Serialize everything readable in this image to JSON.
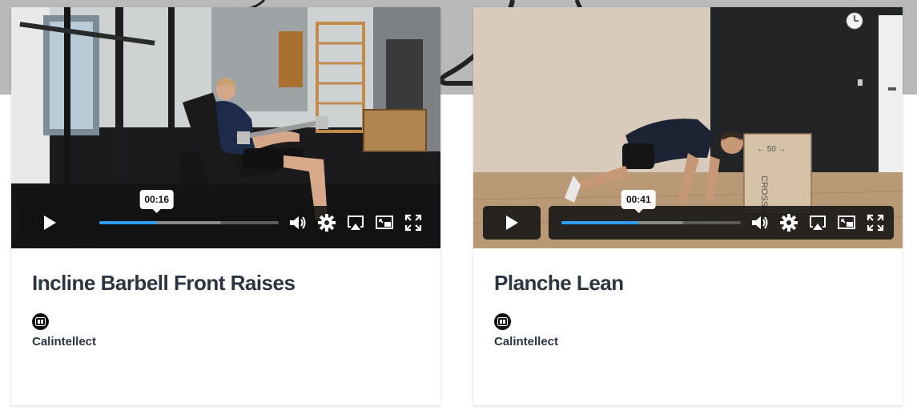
{
  "cards": [
    {
      "title": "Incline Barbell Front Raises",
      "author": "Calintellect",
      "video": {
        "current_time": "00:16",
        "progress": 0.32,
        "buffered": 0.68
      }
    },
    {
      "title": "Planche Lean",
      "author": "Calintellect",
      "video": {
        "current_time": "00:41",
        "progress": 0.43,
        "buffered": 0.68
      }
    }
  ],
  "icons": {
    "play": "play-icon",
    "volume": "volume-icon",
    "settings": "gear-icon",
    "airplay": "airplay-icon",
    "pip": "picture-in-picture-icon",
    "fullscreen": "fullscreen-icon",
    "avatar": "author-logo-icon"
  },
  "colors": {
    "progress": "#2e9bff",
    "title_text": "#2b3440",
    "control_bg": "#121212"
  }
}
